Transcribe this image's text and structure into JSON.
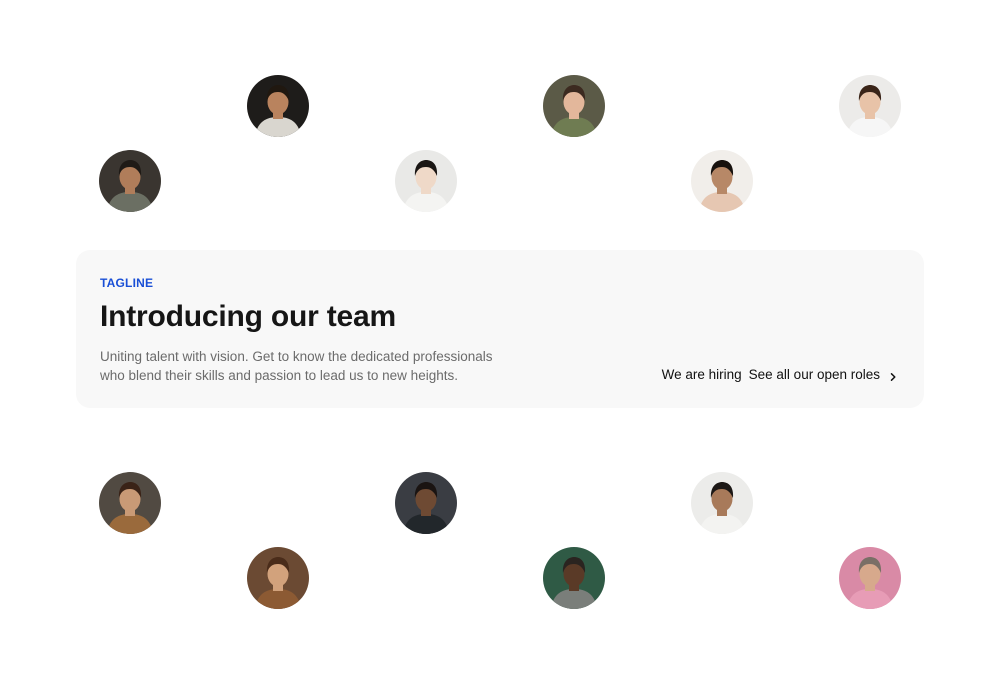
{
  "team_top": [
    {
      "name": "team-member-1",
      "bg": "#3a3530",
      "skin": "#b07d5a",
      "hair": "#1f1a16",
      "shirt": "#6b6f63"
    },
    {
      "name": "team-member-2",
      "bg": "#1e1c1a",
      "skin": "#b9835e",
      "hair": "#201810",
      "shirt": "#d9d6cf"
    },
    {
      "name": "team-member-3",
      "bg": "#e9e9e7",
      "skin": "#efd9c8",
      "hair": "#1a1614",
      "shirt": "#f4f4f2"
    },
    {
      "name": "team-member-4",
      "bg": "#5b5a47",
      "skin": "#e3b79b",
      "hair": "#3c2a20",
      "shirt": "#6f7c52"
    },
    {
      "name": "team-member-5",
      "bg": "#f1eeea",
      "skin": "#b78867",
      "hair": "#17110d",
      "shirt": "#e6c7b2"
    },
    {
      "name": "team-member-6",
      "bg": "#ecebe9",
      "skin": "#e8c3a8",
      "hair": "#3a2418",
      "shirt": "#f6f6f6"
    }
  ],
  "hero": {
    "tagline": "TAGLINE",
    "title": "Introducing our team",
    "description": "Uniting talent with vision. Get to know the dedicated professionals who blend their skills and passion to lead us to new heights.",
    "hiring_label": "We are hiring",
    "roles_link": "See all our open roles",
    "accent_color": "#1a4fd6"
  },
  "team_bottom": [
    {
      "name": "team-member-7",
      "bg": "#514a42",
      "skin": "#c99a76",
      "hair": "#3a2317",
      "shirt": "#9a6a3c"
    },
    {
      "name": "team-member-8",
      "bg": "#6b4a33",
      "skin": "#d2a27c",
      "hair": "#4a2c1a",
      "shirt": "#8c5a33"
    },
    {
      "name": "team-member-9",
      "bg": "#3a3d43",
      "skin": "#6e4a33",
      "hair": "#1a1412",
      "shirt": "#22272b"
    },
    {
      "name": "team-member-10",
      "bg": "#2f5a45",
      "skin": "#5a3a27",
      "hair": "#2a2420",
      "shirt": "#7a7e7a"
    },
    {
      "name": "team-member-11",
      "bg": "#ececea",
      "skin": "#a87a5a",
      "hair": "#1c1816",
      "shirt": "#f3f3f1"
    },
    {
      "name": "team-member-12",
      "bg": "#d98aa6",
      "skin": "#d7a98c",
      "hair": "#7a6f66",
      "shirt": "#e79cb6"
    }
  ]
}
